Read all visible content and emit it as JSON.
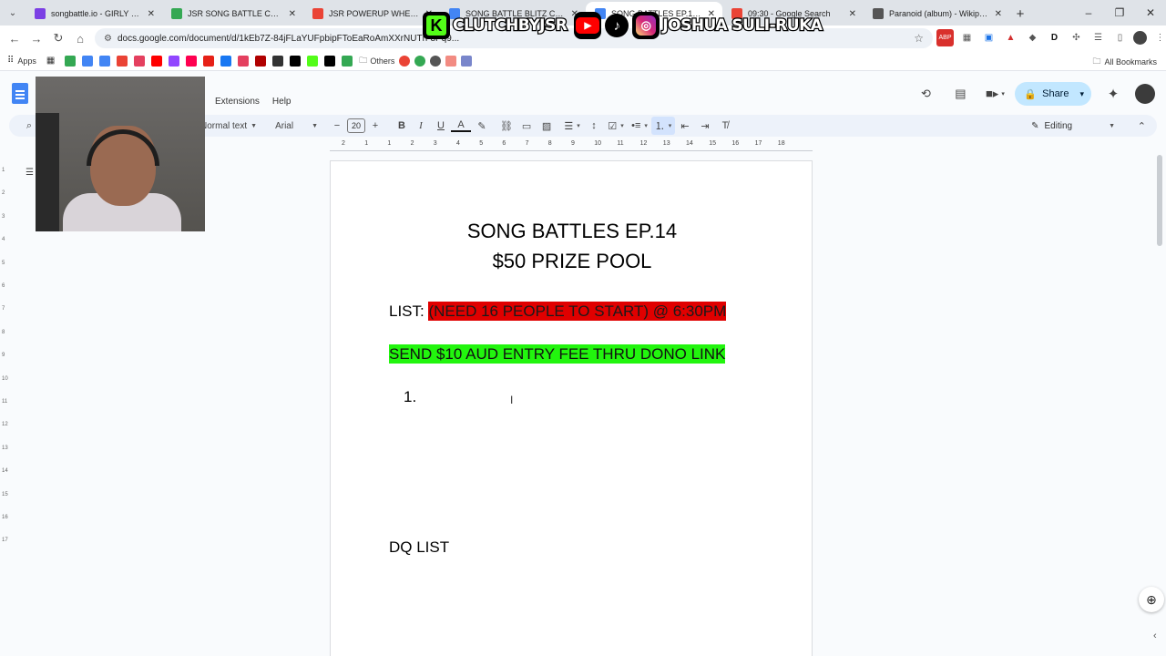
{
  "browser": {
    "tabs": [
      {
        "label": "songbattle.io - GIRLY POP",
        "favicon_color": "#7b3fe4",
        "width": 150,
        "active": false
      },
      {
        "label": "JSR SONG BATTLE CATEGORY",
        "favicon_color": "#34a853",
        "width": 155,
        "active": false
      },
      {
        "label": "JSR POWERUP WHEEL",
        "favicon_color": "#ea4335",
        "width": 150,
        "active": false
      },
      {
        "label": "SONG BATTLE BLITZ COMP - E...",
        "favicon_color": "#4285f4",
        "width": 160,
        "active": false
      },
      {
        "label": "SONG BATTLES EP.15 - Google",
        "favicon_color": "#4285f4",
        "width": 150,
        "active": true
      },
      {
        "label": "09:30 - Google Search",
        "favicon_color": "#ea4335",
        "width": 155,
        "active": false
      },
      {
        "label": "Paranoid (album) - Wikipedia",
        "favicon_color": "#555555",
        "width": 160,
        "active": false
      }
    ],
    "url": "docs.google.com/document/d/1kEb7Z-84jFLaYUFpbipFToEaRoAmXXrNUTn-8Pq9...",
    "bookmarks": {
      "apps_label": "Apps",
      "icons": [
        "#34a853",
        "#4285f4",
        "#4285f4",
        "#ea4335",
        "#e4405f",
        "#ff0000",
        "#9146ff",
        "#ff0050",
        "#e62117",
        "#1877f2",
        "#e4405f",
        "#b00000",
        "#333333",
        "#000000",
        "#53fc18",
        "#000000",
        "#34a853"
      ],
      "others_label": "Others",
      "all_bookmarks_label": "All Bookmarks"
    }
  },
  "docs": {
    "menu": [
      "Extensions",
      "Help"
    ],
    "share_label": "Share",
    "toolbar": {
      "style": "Normal text",
      "font": "Arial",
      "font_size": "20",
      "mode": "Editing"
    },
    "ruler_ticks": [
      "2",
      "1",
      "1",
      "2",
      "3",
      "4",
      "5",
      "6",
      "7",
      "8",
      "9",
      "10",
      "11",
      "12",
      "13",
      "14",
      "15",
      "16",
      "17",
      "18"
    ],
    "vruler_ticks": [
      "1",
      "2",
      "3",
      "4",
      "5",
      "6",
      "7",
      "8",
      "9",
      "10",
      "11",
      "12",
      "13",
      "14",
      "15",
      "16",
      "17"
    ]
  },
  "document": {
    "title_line1": "SONG BATTLES EP.14",
    "title_line2": "$50 PRIZE POOL",
    "list_prefix": "LIST: ",
    "list_highlight": "(NEED 16 PEOPLE TO START) @ 6:30PM",
    "entry_fee": "SEND $10 AUD ENTRY FEE THRU DONO LINK",
    "numbered_item": "1.",
    "dq_list": "DQ LIST"
  },
  "overlay": {
    "kick_handle": "CLUTCHBYJSR",
    "social_handle": "JOSHUA SULI-RUKA",
    "kick_color": "#53fc18",
    "youtube_color": "#ff0000"
  },
  "colors": {
    "highlight_red": "#e00000",
    "highlight_green": "#22f50e",
    "share_bg": "#c2e7ff",
    "docs_blue": "#4285f4"
  }
}
